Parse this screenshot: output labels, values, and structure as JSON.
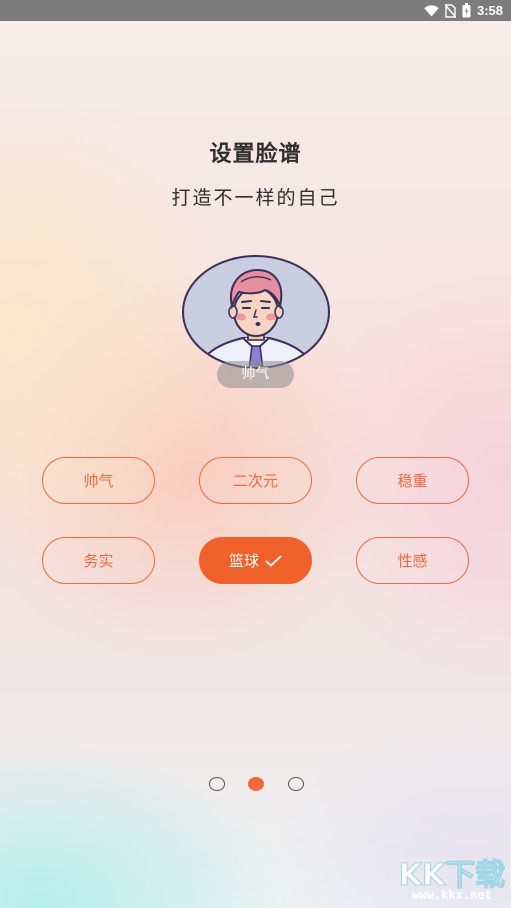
{
  "status_bar": {
    "time": "3:58",
    "icons": [
      "wifi-icon",
      "no-sim-icon",
      "battery-icon"
    ]
  },
  "header": {
    "title": "设置脸谱",
    "subtitle": "打造不一样的自己"
  },
  "avatar": {
    "label": "帅气"
  },
  "tags": [
    {
      "label": "帅气",
      "selected": false
    },
    {
      "label": "二次元",
      "selected": false
    },
    {
      "label": "稳重",
      "selected": false
    },
    {
      "label": "务实",
      "selected": false
    },
    {
      "label": "篮球",
      "selected": true
    },
    {
      "label": "性感",
      "selected": false
    }
  ],
  "pager": {
    "total": 3,
    "current": 2
  },
  "watermark": {
    "text": "KK下载",
    "url": "www.kkx.net"
  },
  "colors": {
    "accent": "#f06a3c",
    "selected_fill": "#f0602a",
    "text_primary": "#2f2f2f"
  }
}
